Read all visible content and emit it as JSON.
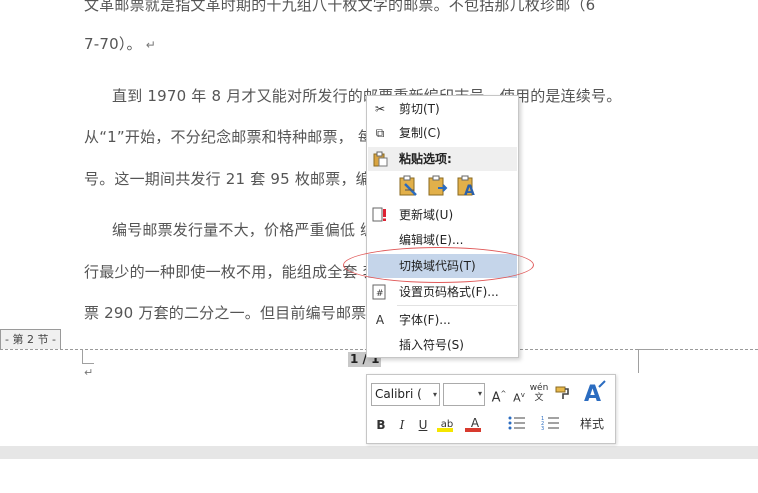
{
  "document": {
    "paragraphs": [
      "文革邮票就是指文革时期的十九组八十枚文字的邮票。不包括那几枚珍邮（6",
      "7-70）。",
      "直到 1970 年 8 月才又能对所发行的邮票重新编印志号，使用的是连续号。",
      "从“1”开始，不分纪念邮票和特种邮票，    每枚编一个顺序",
      "号。这一期间共发行 21 套 95 枚邮票，编                          4）。",
      "编号邮票发行量不大，价格严重偏低             编号邮票，其发",
      "行最少的一种即使一枚不用，能组成全套               套，不足“文”字",
      "票 290 万套的二分之一。但目前编号邮票               格却出现严重倒"
    ],
    "paragraph_mark": "↵"
  },
  "footer": {
    "section_label": "- 第 2 节 -",
    "page_number": "1 / 1"
  },
  "context_menu": {
    "items": [
      {
        "label": "剪切(T)",
        "icon": "scissors-icon",
        "glyph": "✂"
      },
      {
        "label": "复制(C)",
        "icon": "copy-icon",
        "glyph": "⧉"
      },
      {
        "label": "粘贴选项:",
        "icon": "paste-icon",
        "glyph": "📋"
      },
      {
        "label": "更新域(U)",
        "icon": "update-field-icon",
        "glyph": "!"
      },
      {
        "label": "编辑域(E)...",
        "icon": "",
        "glyph": ""
      },
      {
        "label": "切换域代码(T)",
        "icon": "",
        "glyph": ""
      },
      {
        "label": "设置页码格式(F)...",
        "icon": "page-number-format-icon",
        "glyph": "#"
      },
      {
        "label": "字体(F)...",
        "icon": "font-icon",
        "glyph": "A"
      },
      {
        "label": "插入符号(S)",
        "icon": "",
        "glyph": ""
      }
    ],
    "paste_options": [
      "paste-keep-formatting-icon",
      "paste-merge-formatting-icon",
      "paste-text-only-icon"
    ]
  },
  "mini_toolbar": {
    "font_name": "Calibri (",
    "font_size": "",
    "grow_font": "A",
    "shrink_font": "A",
    "phonetic": "wén",
    "format_painter": "",
    "styles_label": "样式",
    "bold": "B",
    "italic": "I",
    "underline": "U",
    "highlight": "ab",
    "font_color": "A"
  },
  "colors": {
    "highlight_item": "#c5d5ea",
    "annotation_oval": "#e05a5a",
    "highlight_yellow": "#f5e600",
    "font_color_red": "#d83a2e",
    "styles_blue": "#2b6cc0"
  }
}
